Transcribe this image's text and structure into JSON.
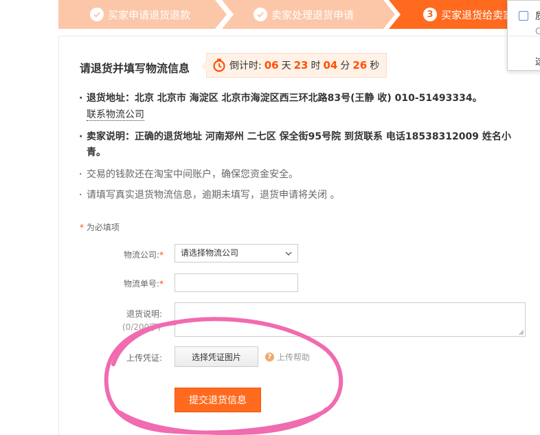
{
  "steps": [
    {
      "label": "买家申请退货退款",
      "state": "done"
    },
    {
      "label": "卖家处理退货申请",
      "state": "done"
    },
    {
      "number": "3",
      "label": "买家退货给卖家",
      "state": "current"
    }
  ],
  "popup": {
    "line1": "质",
    "line2": "C",
    "line3": "这"
  },
  "header": {
    "title": "请退货并填写物流信息",
    "countdown": {
      "prefix": "倒计时:",
      "days": "06",
      "days_unit": "天",
      "hours": "23",
      "hours_unit": "时",
      "minutes": "04",
      "minutes_unit": "分",
      "seconds": "26",
      "seconds_unit": "秒"
    }
  },
  "info": {
    "address_label": "退货地址：",
    "address_text": "北京 北京市 海淀区 北京市海淀区西三环北路83号(王静 收) 010-51493334。",
    "contact_link": "联系物流公司",
    "seller_label": "卖家说明：",
    "seller_text_line1": "正确的退货地址 河南郑州 二七区 保全街95号院 到货联系 电话18538312009 姓名小",
    "seller_text_line2": "青。",
    "note1": "交易的钱款还在淘宝中间账户，确保您资金安全。",
    "note2": "请填写真实退货物流信息，逾期未填写，退货申请将关闭 。"
  },
  "form": {
    "required_star": "*",
    "required_text": "为必填项",
    "company_label": "物流公司:",
    "company_placeholder": "请选择物流公司",
    "tracking_label": "物流单号:",
    "desc_label": "退货说明:",
    "desc_hint": "(0/200字)",
    "upload_label": "上传凭证:",
    "upload_button": "选择凭证图片",
    "upload_help": "上传帮助",
    "submit_button": "提交退货信息"
  },
  "colors": {
    "accent": "#ff6a1f",
    "step_done": "#fcc7a8",
    "annotation": "#f06bb0"
  }
}
